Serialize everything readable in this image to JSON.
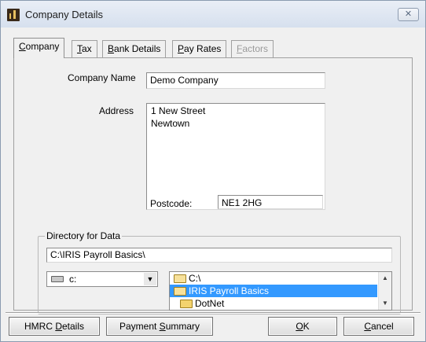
{
  "window": {
    "title": "Company Details",
    "close_glyph": "✕"
  },
  "tabs": [
    {
      "label": "Company",
      "key": "C",
      "rest": "ompany"
    },
    {
      "label": "Tax",
      "key": "T",
      "rest": "ax"
    },
    {
      "label": "Bank Details",
      "key": "B",
      "rest": "ank Details"
    },
    {
      "label": "Pay Rates",
      "key": "P",
      "rest": "ay Rates"
    },
    {
      "label": "Factors",
      "key": "F",
      "rest": "actors"
    }
  ],
  "company": {
    "name_label": "Company Name",
    "name_value": "Demo Company",
    "address_label": "Address",
    "address_line1": "1 New Street",
    "address_line2": "Newtown",
    "postcode_label": "Postcode:",
    "postcode_value": "NE1 2HG"
  },
  "directory": {
    "legend": "Directory for Data",
    "path_value": "C:\\IRIS Payroll Basics\\",
    "drive_value": "c:",
    "folders": [
      {
        "label": "C:\\",
        "selected": false
      },
      {
        "label": "IRIS Payroll Basics",
        "selected": true
      },
      {
        "label": "DotNet",
        "selected": false
      }
    ]
  },
  "buttons": {
    "hmrc": {
      "prefix": "HMRC ",
      "key": "D",
      "rest": "etails"
    },
    "payment": {
      "prefix": "Payment ",
      "key": "S",
      "rest": "ummary"
    },
    "ok": {
      "prefix": "",
      "key": "O",
      "rest": "K"
    },
    "cancel": {
      "prefix": "",
      "key": "C",
      "rest": "ancel"
    }
  },
  "icons": {
    "app": "app-icon",
    "close": "close-icon",
    "drive": "drive-icon",
    "folder": "folder-icon",
    "combo_arrow": "chevron-down-icon"
  },
  "colors": {
    "selection": "#3399ff",
    "dialog_background": "#f0f0f0"
  }
}
